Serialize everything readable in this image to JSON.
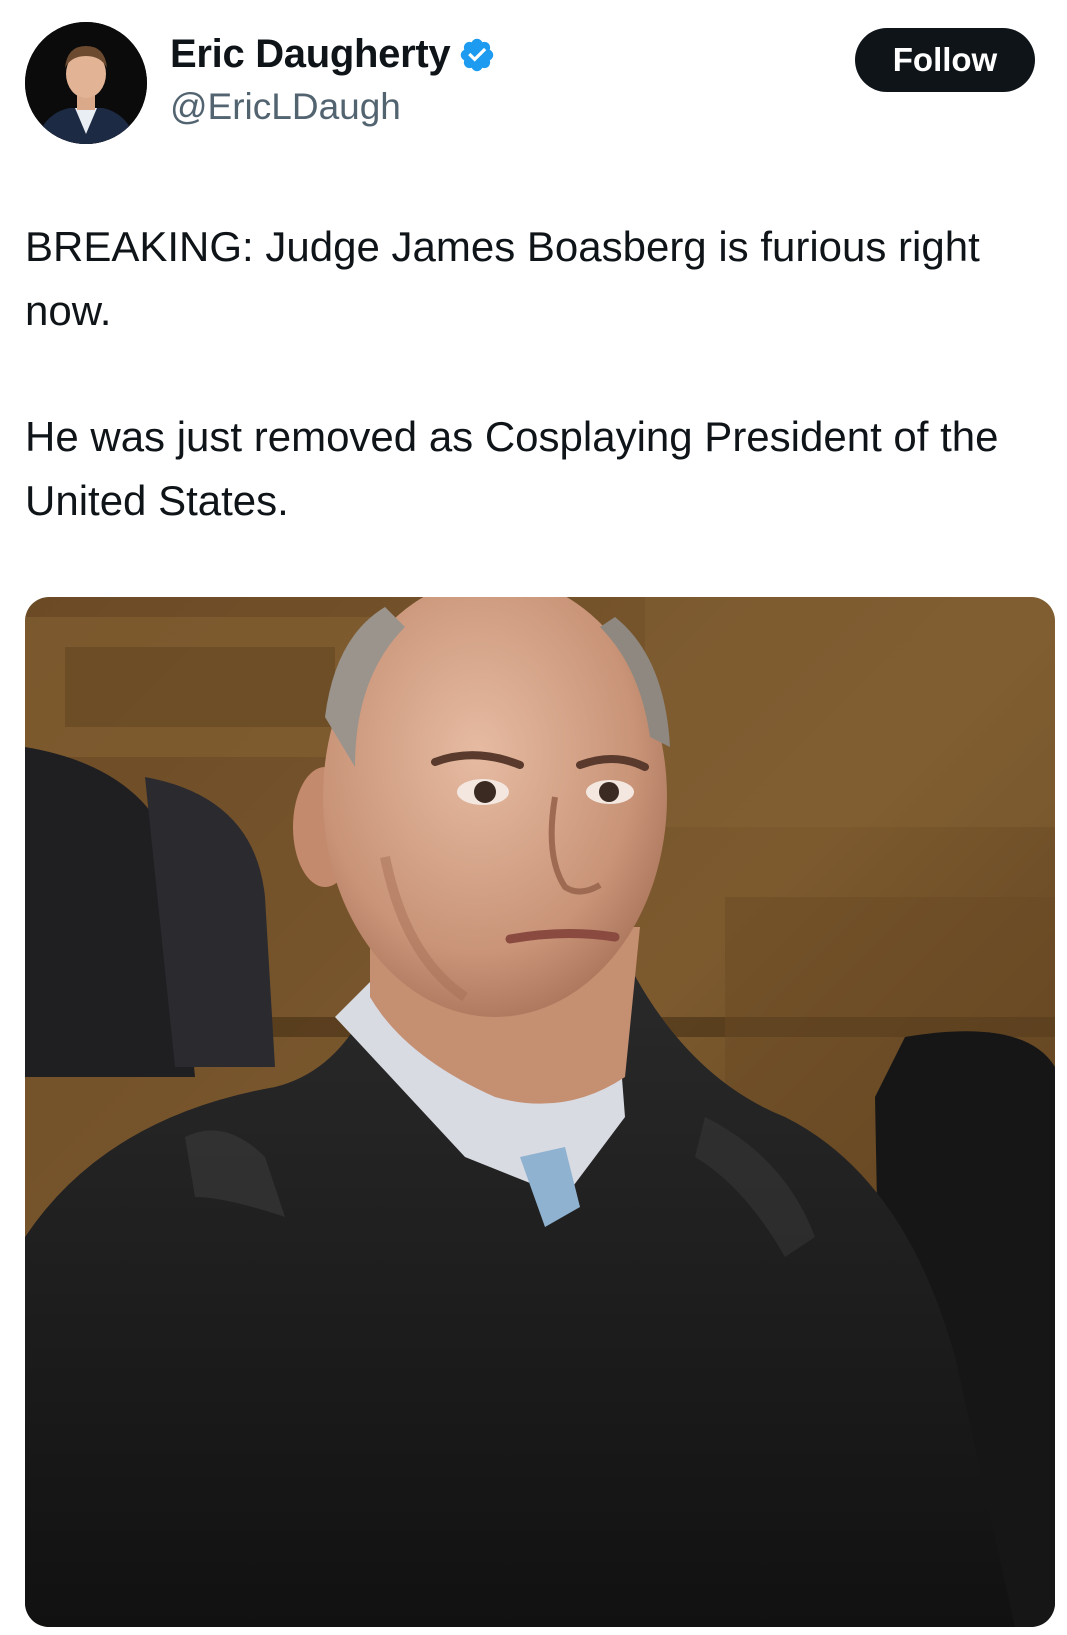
{
  "author": {
    "display_name": "Eric Daugherty",
    "handle": "@EricLDaugh",
    "verified_icon": "verified-badge-icon",
    "avatar_icon": "profile-avatar"
  },
  "follow_button": {
    "label": "Follow"
  },
  "tweet": {
    "paragraphs": [
      "BREAKING: Judge James Boasberg is furious right now.",
      "He was just removed as Cosplaying President of the United States."
    ]
  },
  "media": {
    "icon": "judge-photo"
  },
  "colors": {
    "text": "#0f1419",
    "secondary_text": "#536471",
    "verified_blue": "#1d9bf0",
    "button_bg": "#0f1419"
  }
}
